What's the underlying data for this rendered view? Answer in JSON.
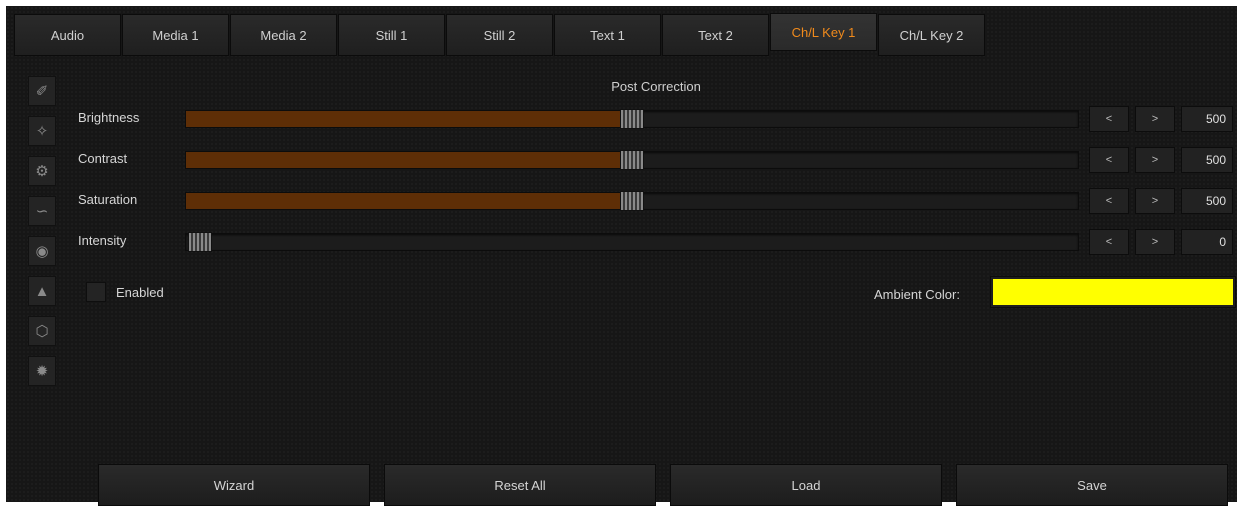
{
  "tabs": [
    {
      "label": "Audio",
      "active": false
    },
    {
      "label": "Media 1",
      "active": false
    },
    {
      "label": "Media 2",
      "active": false
    },
    {
      "label": "Still 1",
      "active": false
    },
    {
      "label": "Still 2",
      "active": false
    },
    {
      "label": "Text 1",
      "active": false
    },
    {
      "label": "Text 2",
      "active": false
    },
    {
      "label": "Ch/L Key 1",
      "active": true
    },
    {
      "label": "Ch/L Key 2",
      "active": false
    }
  ],
  "side_icons": [
    "brush-icon",
    "magic-wand-icon",
    "gear-brush-icon",
    "curve-icon",
    "mask-icon",
    "alert-cone-icon",
    "shape-icon",
    "burst-icon"
  ],
  "section_title": "Post Correction",
  "sliders": [
    {
      "label": "Brightness",
      "value": "500",
      "fraction": 0.5
    },
    {
      "label": "Contrast",
      "value": "500",
      "fraction": 0.5
    },
    {
      "label": "Saturation",
      "value": "500",
      "fraction": 0.5
    },
    {
      "label": "Intensity",
      "value": "0",
      "fraction": 0.0
    }
  ],
  "stepper": {
    "decrement_label": "<",
    "increment_label": ">"
  },
  "enabled": {
    "label": "Enabled",
    "checked": false
  },
  "ambient": {
    "label": "Ambient Color:",
    "color": "#ffff00"
  },
  "buttons": {
    "wizard": "Wizard",
    "reset_all": "Reset All",
    "load": "Load",
    "save": "Save"
  },
  "colors": {
    "accent": "#f08a1c",
    "slider_fill": "#5e2e06"
  }
}
